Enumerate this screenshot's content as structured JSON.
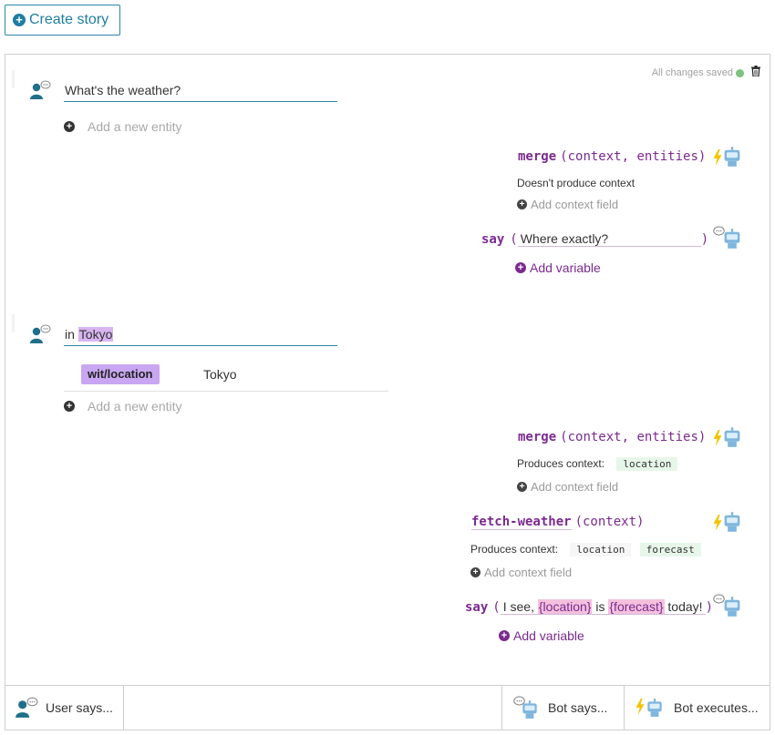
{
  "create_story_label": "Create story",
  "status": {
    "saved_text": "All changes saved",
    "saved_color": "#7dc27d"
  },
  "step1": {
    "user_says": "What's the weather?",
    "add_entity": "Add a new entity"
  },
  "action1": {
    "fn": "merge",
    "args": "(context, entities)",
    "context_text": "Doesn't produce context",
    "add_context": "Add context field"
  },
  "say1": {
    "fn": "say",
    "open": "(",
    "text": "Where exactly?",
    "close": ")",
    "add_variable": "Add variable"
  },
  "step2": {
    "user_prefix": "in ",
    "entity_text": "Tokyo",
    "entity_tag": "wit/location",
    "entity_value": "Tokyo",
    "add_entity": "Add a new entity"
  },
  "action2": {
    "fn": "merge",
    "args": "(context, entities)",
    "context_label": "Produces context:",
    "context_chips": [
      "location"
    ],
    "add_context": "Add context field"
  },
  "action3": {
    "fn": "fetch-weather",
    "args": "(context)",
    "context_label": "Produces context:",
    "context_chips": [
      "location",
      "forecast"
    ],
    "add_context": "Add context field"
  },
  "say2": {
    "fn": "say",
    "open": "(",
    "part1": "I see, ",
    "var1": "{location}",
    "part2": " is ",
    "var2": "{forecast}",
    "part3": " today!",
    "close": ")",
    "add_variable": "Add variable"
  },
  "footer": {
    "user_says": "User says...",
    "bot_says": "Bot says...",
    "bot_executes": "Bot executes..."
  },
  "colors": {
    "accent": "#1f7ea0",
    "purple": "#7b2a8f",
    "entity": "#c9a6f1",
    "bolt": "#f2c400"
  }
}
